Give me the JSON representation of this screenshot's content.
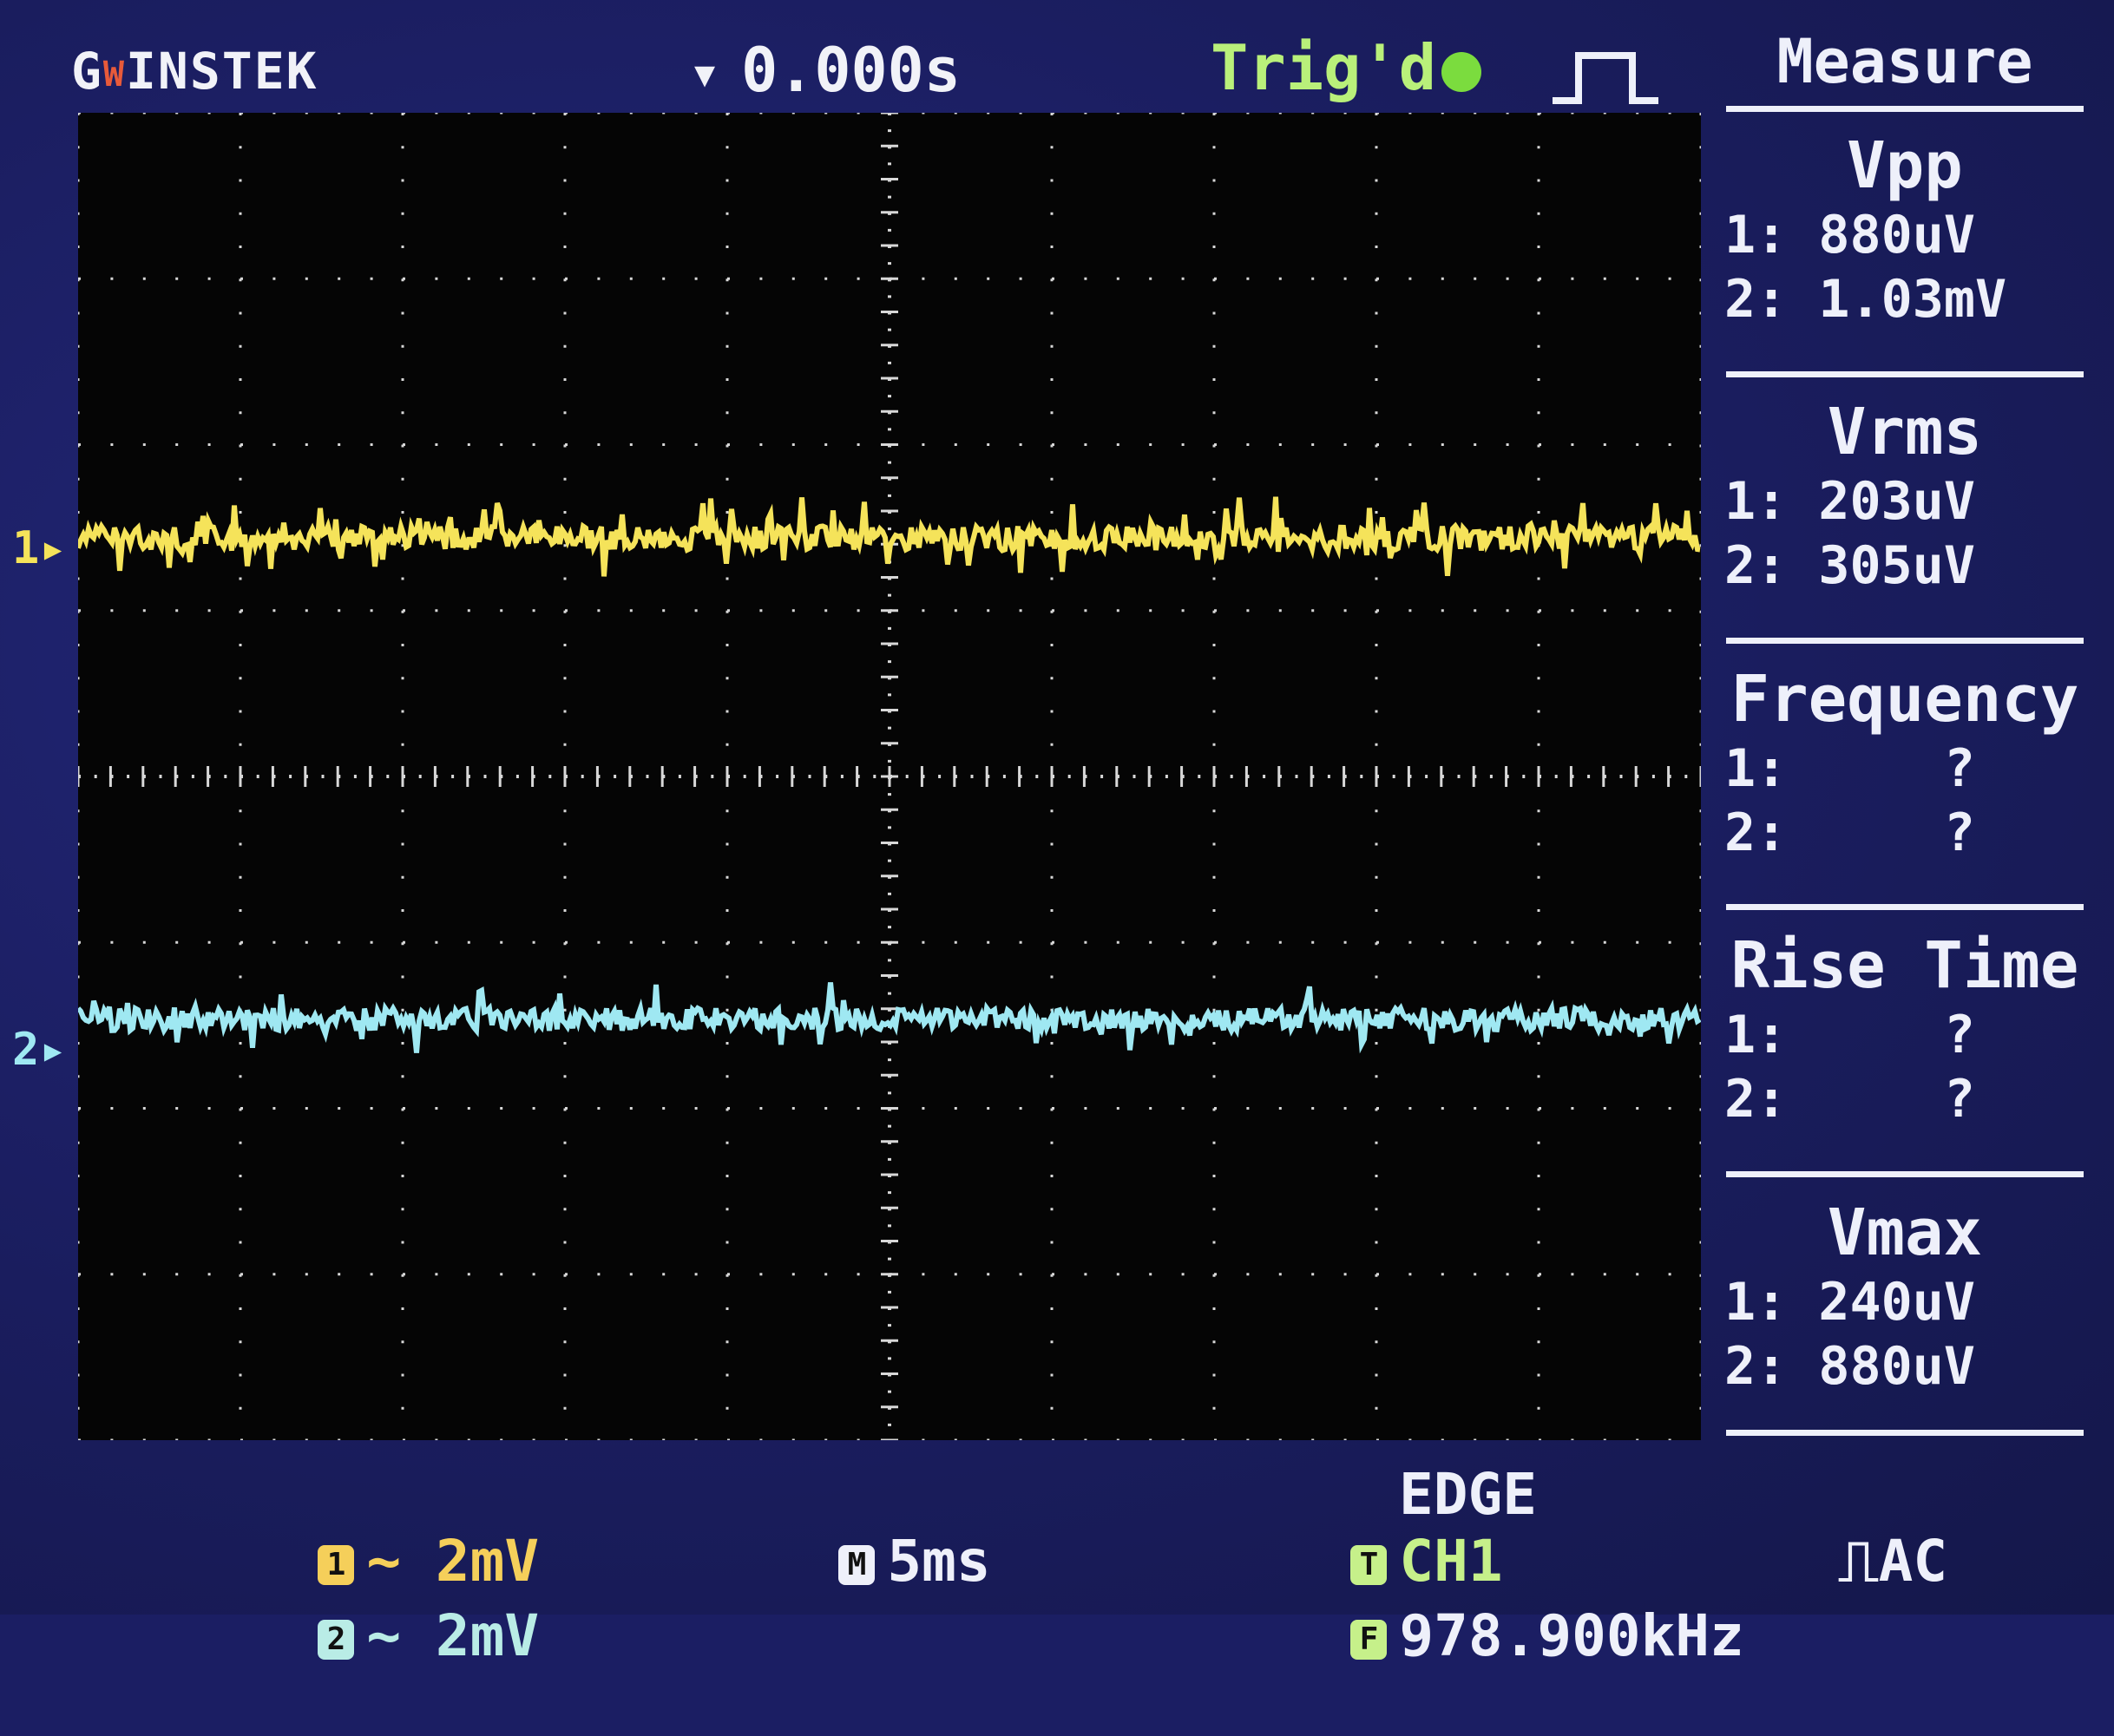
{
  "header": {
    "brand": "GW INSTEK",
    "brand_prefix": "G",
    "brand_mark": "W",
    "brand_name": "INSTEK",
    "time_position": "0.000s",
    "trigger_status": "Trig'd"
  },
  "channels": {
    "ch1_marker": "1",
    "ch2_marker": "2",
    "ch1_color": "#f5e35a",
    "ch2_color": "#9fe8f2"
  },
  "measure": {
    "title": "Measure",
    "items": [
      {
        "name": "Vpp",
        "ch1": "1: 880uV",
        "ch2": "2: 1.03mV"
      },
      {
        "name": "Vrms",
        "ch1": "1: 203uV",
        "ch2": "2: 305uV"
      },
      {
        "name": "Frequency",
        "ch1": "1:     ?",
        "ch2": "2:     ?"
      },
      {
        "name": "Rise Time",
        "ch1": "1:     ?",
        "ch2": "2:     ?"
      },
      {
        "name": "Vmax",
        "ch1": "1: 240uV",
        "ch2": "2: 880uV"
      }
    ]
  },
  "status": {
    "ch1_badge": "1",
    "ch1_scale": "~ 2mV",
    "ch2_badge": "2",
    "ch2_scale": "~ 2mV",
    "time_badge": "M",
    "time_scale": "5ms",
    "trig_badge": "T",
    "trig_source": "CH1",
    "trig_type": "EDGE",
    "trig_coupling": "AC",
    "freq_badge": "F",
    "trig_frequency": "978.900kHz"
  },
  "icons": {
    "trigger_position": "trigger-position-icon",
    "trigger_led": "trigger-status-led-icon",
    "pulse": "pulse-waveform-icon",
    "edge_slope": "rising-edge-icon"
  }
}
